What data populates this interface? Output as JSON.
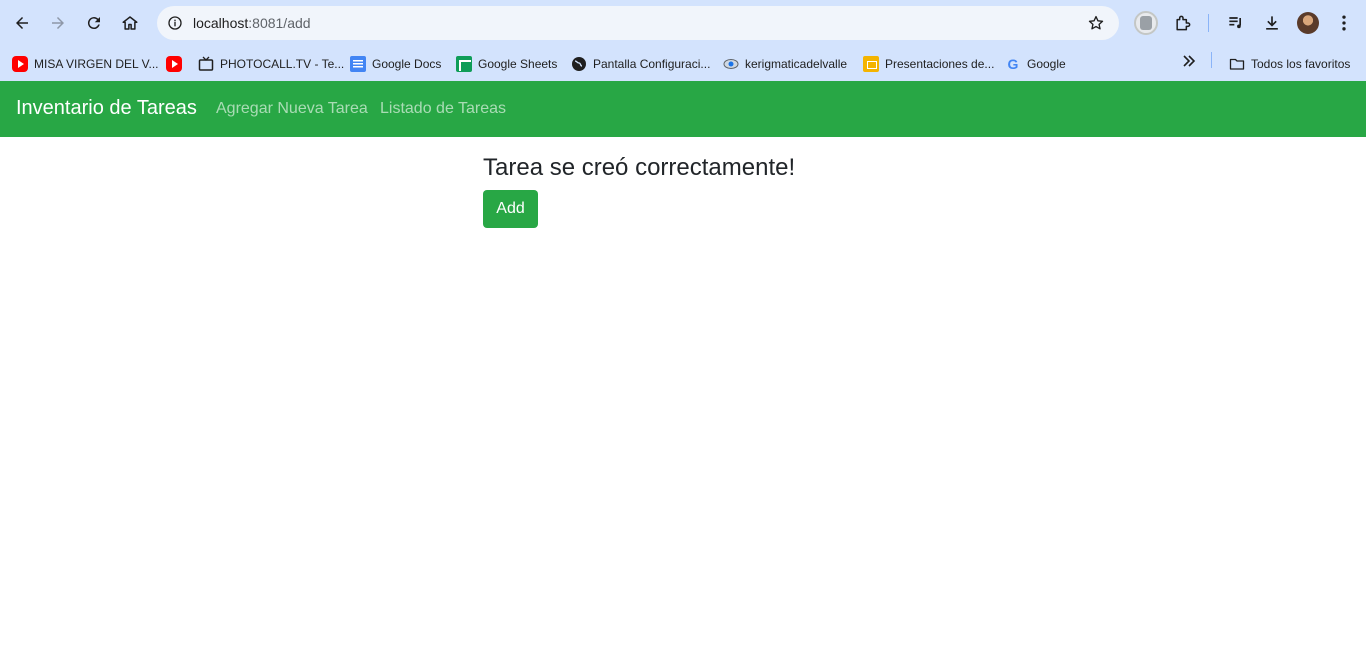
{
  "browser": {
    "url_host": "localhost",
    "url_path": ":8081/add",
    "bookmarks": [
      {
        "label": "MISA VIRGEN DEL V...",
        "icon": "youtube-icon"
      },
      {
        "label": "",
        "icon": "youtube-icon"
      },
      {
        "label": "PHOTOCALL.TV - Te...",
        "icon": "tv-icon"
      },
      {
        "label": "Google Docs",
        "icon": "google-docs-icon"
      },
      {
        "label": "Google Sheets",
        "icon": "google-sheets-icon"
      },
      {
        "label": "Pantalla Configuraci...",
        "icon": "globe-icon"
      },
      {
        "label": "kerigmaticadelvalle",
        "icon": "eye-icon"
      },
      {
        "label": "Presentaciones de...",
        "icon": "google-slides-icon"
      },
      {
        "label": "Google",
        "icon": "google-icon"
      }
    ],
    "all_bookmarks_label": "Todos los favoritos"
  },
  "navbar": {
    "brand": "Inventario de Tareas",
    "links": [
      "Agregar Nueva Tarea",
      "Listado de Tareas"
    ],
    "color": "#28a745"
  },
  "main": {
    "message": "Tarea se creó correctamente!",
    "add_button": "Add"
  }
}
